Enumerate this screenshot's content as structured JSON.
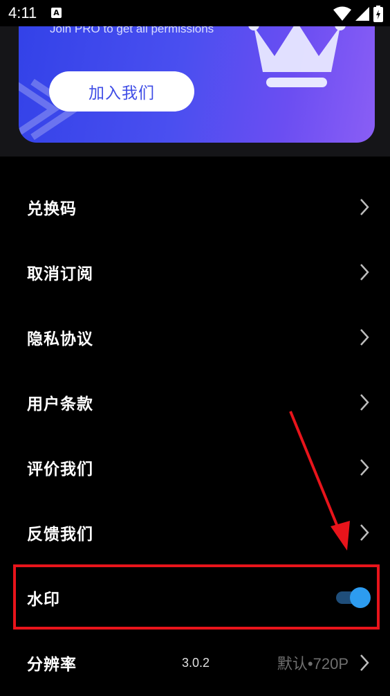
{
  "status_bar": {
    "time": "4:11",
    "notification_icon": "A",
    "icons": [
      "wifi-icon",
      "signal-icon",
      "battery-icon"
    ]
  },
  "promo": {
    "subtitle": "Join PRO to get all permissions",
    "join_button_label": "加入我们",
    "icon": "crown-icon",
    "colors": {
      "gradient_start": "#3342e8",
      "gradient_end": "#8a5ef5",
      "button_text": "#3f4de6"
    }
  },
  "menu": {
    "items": [
      {
        "label": "兑换码",
        "type": "link"
      },
      {
        "label": "取消订阅",
        "type": "link"
      },
      {
        "label": "隐私协议",
        "type": "link"
      },
      {
        "label": "用户条款",
        "type": "link"
      },
      {
        "label": "评价我们",
        "type": "link"
      },
      {
        "label": "反馈我们",
        "type": "link"
      },
      {
        "label": "水印",
        "type": "toggle",
        "enabled": true
      },
      {
        "label": "分辨率",
        "type": "link",
        "version": "3.0.2",
        "value": "默认•720P"
      }
    ]
  },
  "colors": {
    "background": "#000000",
    "toggle_on": "#2d9cf0",
    "annotation": "#e8141b"
  }
}
